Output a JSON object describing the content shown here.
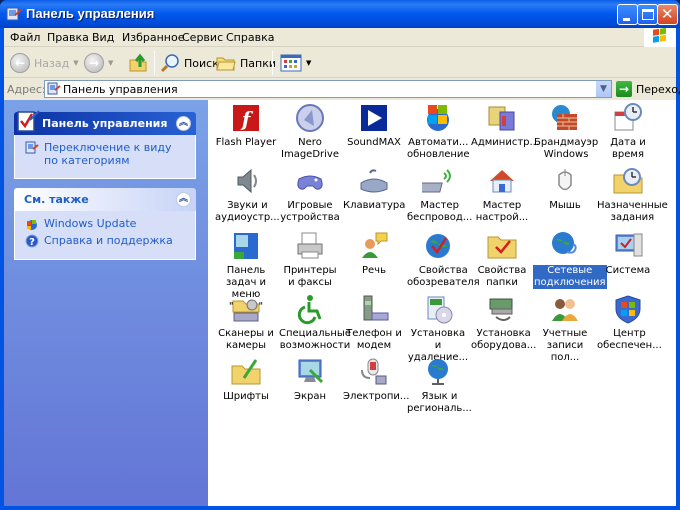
{
  "window": {
    "title": "Панель управления",
    "controls": {
      "minimize": "minimize-button",
      "maximize": "maximize-button",
      "close": "close-button"
    }
  },
  "menu": [
    "Файл",
    "Правка",
    "Вид",
    "Избранное",
    "Сервис",
    "Справка"
  ],
  "toolbar": {
    "back": "Назад",
    "forward": "",
    "search": "Поиск",
    "folders": "Папки"
  },
  "address": {
    "label": "Адрес:",
    "value": "Панель управления",
    "go": "Переход"
  },
  "sidebar": {
    "panel1": {
      "title": "Панель управления",
      "links": [
        "Переключение к виду по категориям"
      ]
    },
    "panel2": {
      "title": "См. также",
      "links": [
        "Windows Update",
        "Справка и поддержка"
      ]
    }
  },
  "items": [
    {
      "label": "Flash Player",
      "icon": "flash-icon"
    },
    {
      "label": "Nero ImageDrive",
      "icon": "nero-icon"
    },
    {
      "label": "SoundMAX",
      "icon": "soundmax-icon"
    },
    {
      "label": "Автомати... обновление",
      "icon": "automatic-updates-icon"
    },
    {
      "label": "Администр...",
      "icon": "admin-tools-icon"
    },
    {
      "label": "Брандмауэр Windows",
      "icon": "firewall-icon"
    },
    {
      "label": "Дата и время",
      "icon": "date-time-icon"
    },
    {
      "label": "Звуки и аудиоустр...",
      "icon": "sound-icon"
    },
    {
      "label": "Игровые устройства",
      "icon": "game-controller-icon"
    },
    {
      "label": "Клавиатура",
      "icon": "keyboard-icon"
    },
    {
      "label": "Мастер беспровод...",
      "icon": "wireless-wizard-icon"
    },
    {
      "label": "Мастер настрой...",
      "icon": "network-wizard-icon"
    },
    {
      "label": "Мышь",
      "icon": "mouse-icon"
    },
    {
      "label": "Назначенные задания",
      "icon": "scheduled-tasks-icon"
    },
    {
      "label": "Панель задач и меню \"Пуск\"",
      "icon": "taskbar-icon"
    },
    {
      "label": "Принтеры и факсы",
      "icon": "printer-icon"
    },
    {
      "label": "Речь",
      "icon": "speech-icon"
    },
    {
      "label": "Свойства обозревателя",
      "icon": "internet-options-icon"
    },
    {
      "label": "Свойства папки",
      "icon": "folder-options-icon"
    },
    {
      "label": "Сетевые подключения",
      "icon": "network-connections-icon",
      "selected": true
    },
    {
      "label": "Система",
      "icon": "system-icon"
    },
    {
      "label": "Сканеры и камеры",
      "icon": "scanner-icon"
    },
    {
      "label": "Специальные возможности",
      "icon": "accessibility-icon"
    },
    {
      "label": "Телефон и модем",
      "icon": "phone-modem-icon"
    },
    {
      "label": "Установка и удаление...",
      "icon": "add-remove-icon"
    },
    {
      "label": "Установка оборудова...",
      "icon": "add-hardware-icon"
    },
    {
      "label": "Учетные записи пол...",
      "icon": "user-accounts-icon"
    },
    {
      "label": "Центр обеспечен...",
      "icon": "security-center-icon"
    },
    {
      "label": "Шрифты",
      "icon": "fonts-icon"
    },
    {
      "label": "Экран",
      "icon": "display-icon"
    },
    {
      "label": "Электропи...",
      "icon": "power-options-icon"
    },
    {
      "label": "Язык и региональ...",
      "icon": "regional-icon"
    }
  ]
}
